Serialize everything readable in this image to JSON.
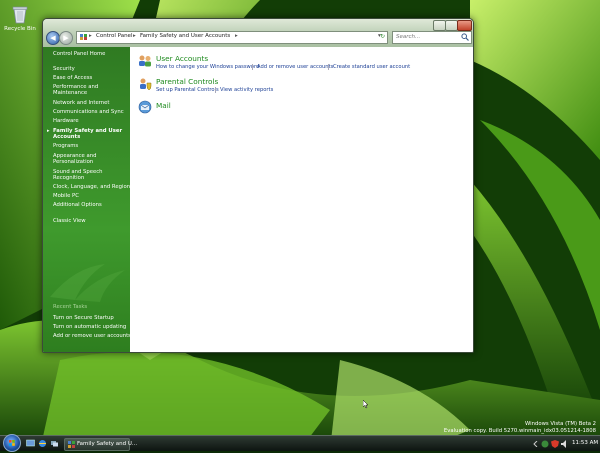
{
  "desktop": {
    "recycle_bin_label": "Recycle Bin"
  },
  "window": {
    "address": {
      "crumbs": [
        "Control Panel",
        "Family Safety and User Accounts"
      ]
    },
    "search_placeholder": "Search...",
    "sidebar": {
      "home": "Control Panel Home",
      "items": [
        "Security",
        "Ease of Access",
        "Performance and",
        "Maintenance",
        "Network and Internet",
        "Communications and Sync",
        "Hardware",
        "Family Safety and User",
        "Accounts",
        "Programs",
        "Appearance and",
        "Personalization",
        "Sound and Speech",
        "Recognition",
        "Clock, Language, and Region",
        "Mobile PC",
        "Additional Options"
      ],
      "classic_view": "Classic View",
      "recent_tasks_header": "Recent Tasks",
      "recent_tasks": [
        "Turn on Secure Startup",
        "Turn on automatic updating",
        "Add or remove user accounts"
      ]
    },
    "categories": [
      {
        "title": "User Accounts",
        "links": [
          "How to change your Windows password",
          "Add or remove user accounts",
          "Create standard user account"
        ]
      },
      {
        "title": "Parental Controls",
        "links": [
          "Set up Parental Controls",
          "View activity reports"
        ]
      },
      {
        "title": "Mail",
        "links": []
      }
    ]
  },
  "taskbar": {
    "task_label": "Family Safety and U...",
    "clock": "11:53 AM"
  },
  "watermark": {
    "line1": "Windows Vista (TM) Beta 2",
    "line2": "Evaluation copy. Build 5270.winmain_idx03.051214-1808"
  }
}
